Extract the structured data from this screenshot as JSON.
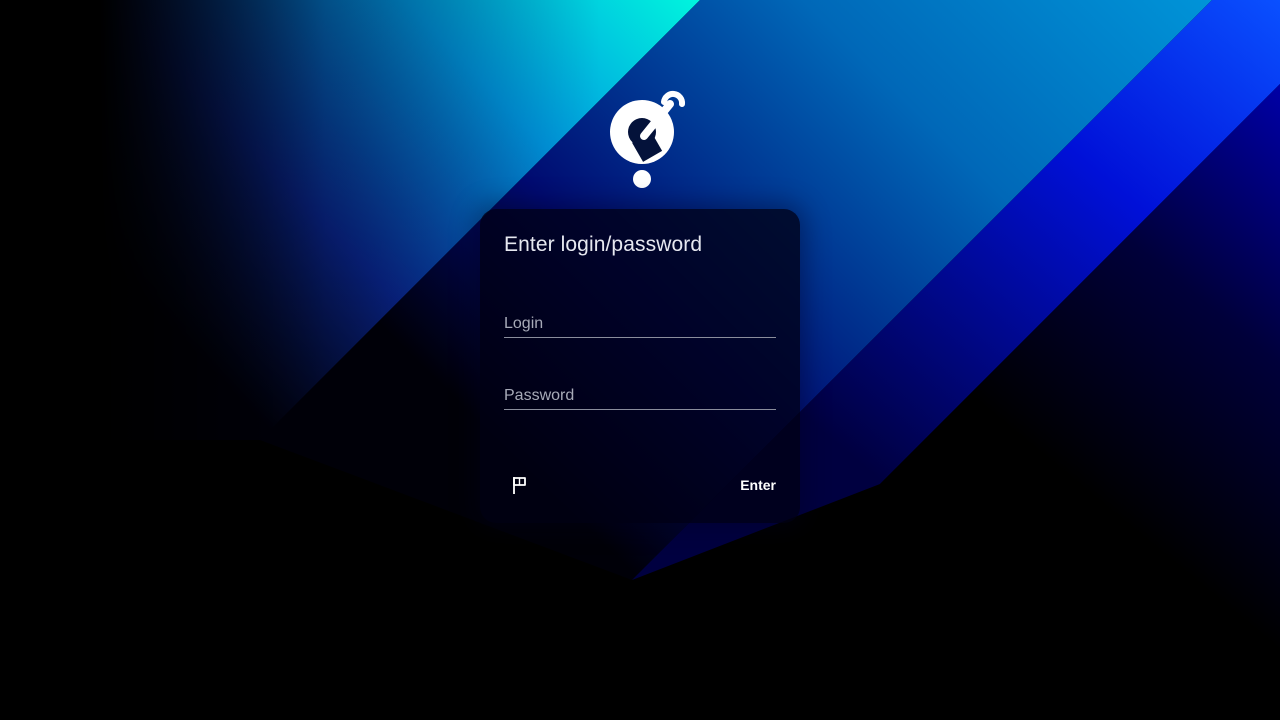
{
  "login_form": {
    "title": "Enter login/password",
    "login_placeholder": "Login",
    "login_value": "",
    "password_placeholder": "Password",
    "password_value": "",
    "enter_label": "Enter"
  },
  "icons": {
    "logo": "app-logo-icon",
    "language": "flag-icon"
  },
  "colors": {
    "background": "#000000",
    "accent_cyan": "#00f0e0",
    "accent_blue": "#0078d8",
    "accent_deep_blue": "#0010d0",
    "text_primary": "#e6e8f0",
    "text_placeholder": "#a7aab8"
  }
}
